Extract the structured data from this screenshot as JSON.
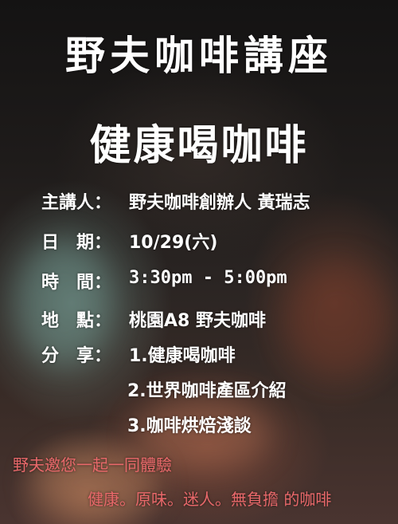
{
  "series_title": "野夫咖啡講座",
  "main_title": "健康喝咖啡",
  "details": {
    "speaker_label": "主講人：",
    "speaker_value": "野夫咖啡創辦人 黃瑞志",
    "date_label": "日　期：",
    "date_value": "10/29(六)",
    "time_label": "時　間：",
    "time_value": "3:30pm - 5:00pm",
    "place_label": "地　點：",
    "place_value": "桃園A8 野夫咖啡",
    "share_label": "分　享：",
    "share_items": [
      "1.健康喝咖啡",
      "2.世界咖啡產區介紹",
      "3.咖啡烘焙淺談"
    ]
  },
  "invite_text": "野夫邀您一起一同體驗",
  "tagline": "健康。原味。迷人。無負擔 的咖啡",
  "colors": {
    "accent_text": "#e8686a",
    "main_text": "#ffffff"
  }
}
